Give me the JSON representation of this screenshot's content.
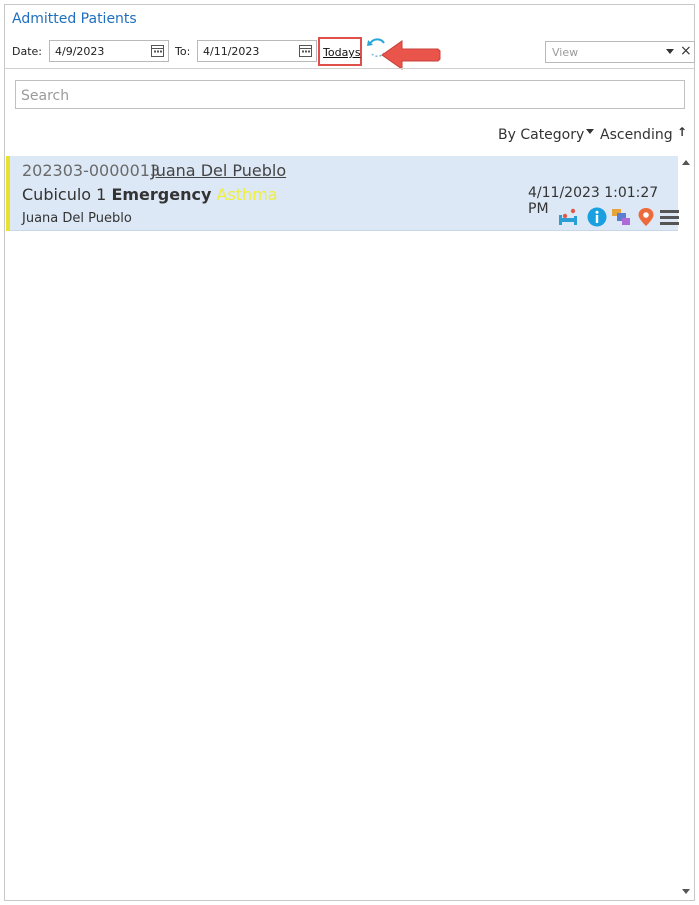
{
  "header": {
    "title": "Admitted Patients"
  },
  "filters": {
    "date_label": "Date:",
    "from_value": "4/9/2023",
    "to_label": "To:",
    "to_value": "4/11/2023",
    "todays_link": "Todays",
    "view_placeholder": "View",
    "view_clear": "×"
  },
  "search": {
    "placeholder": "Search"
  },
  "sort": {
    "by": "By Category",
    "direction": "Ascending",
    "direction_icon": "↑"
  },
  "patients": [
    {
      "id": "202303-0000013",
      "name": "Juana Del Pueblo",
      "location": "Cubiculo 1",
      "department": "Emergency",
      "diagnosis": "Asthma",
      "datetime": "4/11/2023 1:01:27 PM",
      "display_name": "Juana Del Pueblo",
      "flag_color": "#e8e232",
      "icons": [
        "bed-icon",
        "info-icon",
        "transfer-icon",
        "location-pin-icon",
        "menu-icon"
      ]
    }
  ],
  "colors": {
    "accent": "#1f6fbf",
    "selected_row": "#dce8f5",
    "highlight": "#e0504a"
  }
}
